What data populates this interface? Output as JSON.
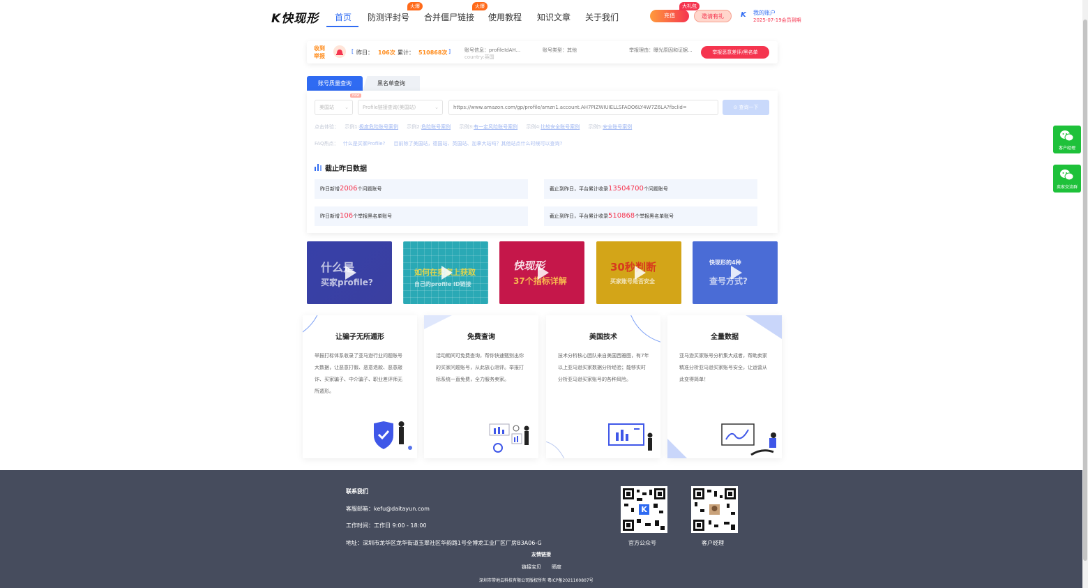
{
  "header": {
    "logo": "快现形",
    "nav": [
      {
        "label": "首页",
        "active": true
      },
      {
        "label": "防测评封号"
      },
      {
        "label": "合并僵尸链接"
      },
      {
        "label": "使用教程"
      },
      {
        "label": "知识文章"
      },
      {
        "label": "关于我们"
      }
    ],
    "hot_badge": "火爆",
    "recharge": "充值",
    "gift_badge": "大礼包",
    "invite": "邀请有礼",
    "account_label": "我的账户",
    "expiry": "2025-07-19会员到期"
  },
  "notice": {
    "tag_line1": "收到",
    "tag_line2": "举报",
    "yesterday_label": "昨日：",
    "yesterday_value": "106次",
    "total_label": "累计：",
    "total_value": "510868次",
    "account_info": "账号信息：profileIdAH...",
    "account_extra": "country:英国",
    "account_type": "账号类型：其他",
    "report_reason": "举报理由：曝光原因和证据...",
    "report_button": "举报恶意差评/黑名单"
  },
  "tabs": [
    "账号质量查询",
    "黑名单查询"
  ],
  "query": {
    "site_select": "美国站",
    "type_select": "Profile链接查询(美国站)",
    "url_placeholder": "https://www.amazon.com/gp/profile/amzn1.account.AH7PIZWIUIELLSFAOO6LY4W7Z6LA?fbclid=",
    "button": "查询一下",
    "new_badge": "new",
    "example_intro": "点击体验：",
    "examples": [
      {
        "prefix": "示例1:",
        "label": "极度危险账号案例"
      },
      {
        "prefix": "示例2:",
        "label": "危险账号案例"
      },
      {
        "prefix": "示例3:",
        "label": "有一定风险账号案例"
      },
      {
        "prefix": "示例4:",
        "label": "比较安全账号案例"
      },
      {
        "prefix": "示例5:",
        "label": "安全账号案例"
      }
    ],
    "faq_label": "FAQ热点：",
    "faq": [
      "什么是买家Profile?",
      "目前除了美国站，德国站、英国站、加拿大站吗？其他站点什么时候可以查询?"
    ]
  },
  "stats": {
    "title": "截止昨日数据",
    "items": [
      {
        "prefix": "昨日新增",
        "value": "2006",
        "suffix": "个问题账号"
      },
      {
        "prefix": "截止到昨日，平台累计收录",
        "value": "13504700",
        "suffix": "个问题账号"
      },
      {
        "prefix": "昨日新增",
        "value": "106",
        "suffix": "个举报黑名单账号"
      },
      {
        "prefix": "截止到昨日，平台累计收录",
        "value": "510868",
        "suffix": "个举报黑名单账号"
      }
    ]
  },
  "videos": [
    {
      "line1": "什么是",
      "line2": "买家profile?"
    },
    {
      "line1": "如何在卖家上获取",
      "line2": "自己的profile ID链接"
    },
    {
      "line1": "快现形",
      "line2": "37个指标详解"
    },
    {
      "line1": "30秒判断",
      "line2": "买家账号是否安全"
    },
    {
      "line1": "快现形的4种",
      "line2": "查号方式?"
    }
  ],
  "features": [
    {
      "title": "让骗子无所遁形",
      "text": "举报打标体系收录了亚马逊行业问题账号大数据，让恶意打假、恶意退款、恶意敲诈、买家骗子、中介骗子、职业差评师无所遁形。"
    },
    {
      "title": "免费查询",
      "text": "活动期间可免费查询，帮你快速甄别出你的买家问题账号，从此放心测评。举报打标系统一直免费，全力服务卖家。"
    },
    {
      "title": "美国技术",
      "text": "技术分析核心团队来自美国西雅图，有7年以上亚马逊买家数据分析经验；能够实时分析亚马逊买家账号的各种风险。"
    },
    {
      "title": "全量数据",
      "text": "亚马逊买家账号分析集大成者，帮助卖家精准分析亚马逊买家账号安全，让运营从此变得简单！"
    }
  ],
  "footer": {
    "contact_title": "联系我们",
    "email_label": "客服邮箱：",
    "email": "kefu@daitayun.com",
    "hours_label": "工作时间：",
    "hours": "工作日 9:00 - 18:00",
    "address_label": "地址：",
    "address": "深圳市龙华区龙华街道玉翠社区华韵路1号全博龙工业厂区厂房B3A06-G",
    "links_title": "友情链接",
    "links": [
      "链接宝贝",
      "晒度"
    ],
    "copyright": "深圳市带地云科技有限公司版权所有 粤ICP备2021100807号",
    "qr1_label": "官方公众号",
    "qr2_label": "客户经理"
  },
  "side": [
    "客户经理",
    "卖家交流群"
  ],
  "colors": {
    "brand_blue": "#2f6bf2",
    "accent_red": "#f5354f",
    "orange": "#ff8a18",
    "footer_bg": "#464c5d",
    "wechat_green": "#1ec13a"
  }
}
